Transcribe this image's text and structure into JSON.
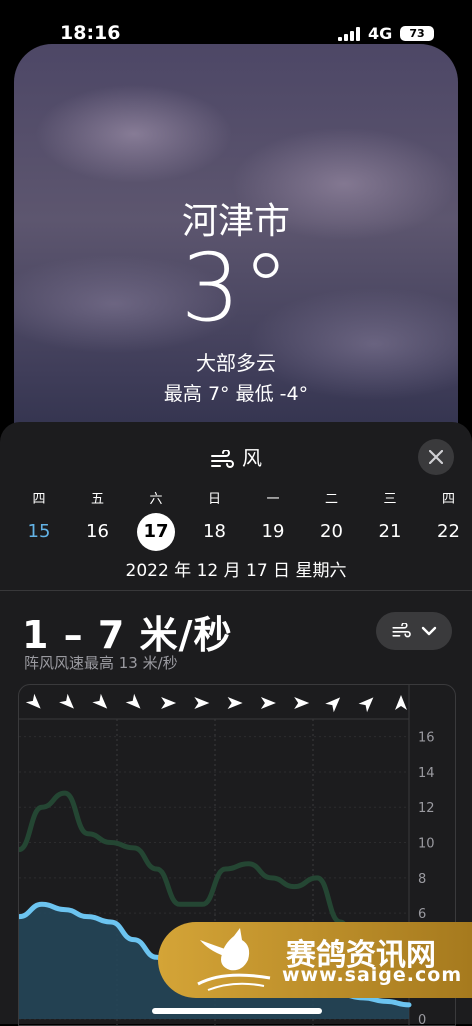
{
  "status": {
    "time": "18:16",
    "network": "4G",
    "battery": "73"
  },
  "weather": {
    "city": "河津市",
    "temp": "3°",
    "condition": "大部多云",
    "hilo": "最高 7°  最低 -4°"
  },
  "sheet": {
    "title": "风",
    "close_label": "✕",
    "week": [
      {
        "wd": "四",
        "day": "15",
        "state": "today"
      },
      {
        "wd": "五",
        "day": "16",
        "state": ""
      },
      {
        "wd": "六",
        "day": "17",
        "state": "selected"
      },
      {
        "wd": "日",
        "day": "18",
        "state": ""
      },
      {
        "wd": "一",
        "day": "19",
        "state": ""
      },
      {
        "wd": "二",
        "day": "20",
        "state": ""
      },
      {
        "wd": "三",
        "day": "21",
        "state": ""
      },
      {
        "wd": "四",
        "day": "22",
        "state": ""
      }
    ],
    "full_date": "2022 年 12 月 17 日 星期六",
    "range": "1 – 7 米/秒",
    "gust": "阵风风速最高 13 米/秒"
  },
  "chart_data": {
    "type": "area",
    "y_ticks": [
      "16",
      "14",
      "12",
      "10",
      "8",
      "6",
      "0"
    ],
    "ylim": [
      0,
      17
    ],
    "direction_arrows_deg": [
      135,
      135,
      135,
      135,
      90,
      90,
      90,
      90,
      90,
      45,
      45,
      0
    ],
    "series": [
      {
        "values": [
          9.6,
          12,
          12.8,
          10.5,
          10,
          9.7,
          8.5,
          6.5,
          6.5,
          8.5,
          8.8,
          8,
          7.5,
          8,
          5.5,
          3,
          2,
          1.8
        ]
      },
      {
        "values": [
          5.8,
          6.5,
          6.2,
          5.8,
          5.5,
          4.5,
          3.5,
          2.5,
          2,
          1.8,
          1.5,
          1.5,
          1.5,
          1.5,
          1.4,
          1.2,
          1.0,
          0.8
        ]
      }
    ]
  },
  "watermark": {
    "text": "赛鸽资讯网",
    "url": "www.saige.com"
  }
}
